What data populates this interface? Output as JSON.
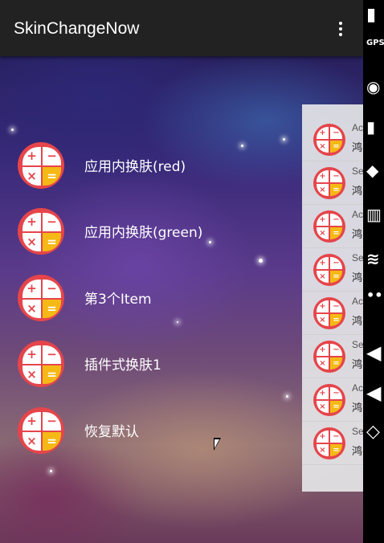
{
  "app": {
    "title": "SkinChangeNow"
  },
  "menu": {
    "items": [
      {
        "label": "应用内换肤(red)"
      },
      {
        "label": "应用内换肤(green)"
      },
      {
        "label": "第3个Item"
      },
      {
        "label": "插件式换肤1"
      },
      {
        "label": "恢复默认"
      }
    ]
  },
  "icon": {
    "plus": "+",
    "minus": "−",
    "times": "×",
    "equals": "="
  },
  "side_panel": {
    "rows": [
      {
        "title": "Ac",
        "sub": "鸿"
      },
      {
        "title": "Se",
        "sub": "鸿"
      },
      {
        "title": "Ac",
        "sub": "鸿"
      },
      {
        "title": "Se",
        "sub": "鸿"
      },
      {
        "title": "Ac",
        "sub": "鸿"
      },
      {
        "title": "Se",
        "sub": "鸿"
      },
      {
        "title": "Ac",
        "sub": "鸿"
      },
      {
        "title": "Se",
        "sub": "鸿"
      }
    ]
  },
  "emulator": {
    "gps_label": "GPS",
    "marks": [
      "◉",
      "▮",
      "◆",
      "▥",
      "≋",
      "••",
      "◀",
      "◀",
      "◇"
    ]
  },
  "colors": {
    "toolbar": "#222222",
    "icon_red": "#e5454b",
    "icon_yellow": "#f5b915"
  }
}
